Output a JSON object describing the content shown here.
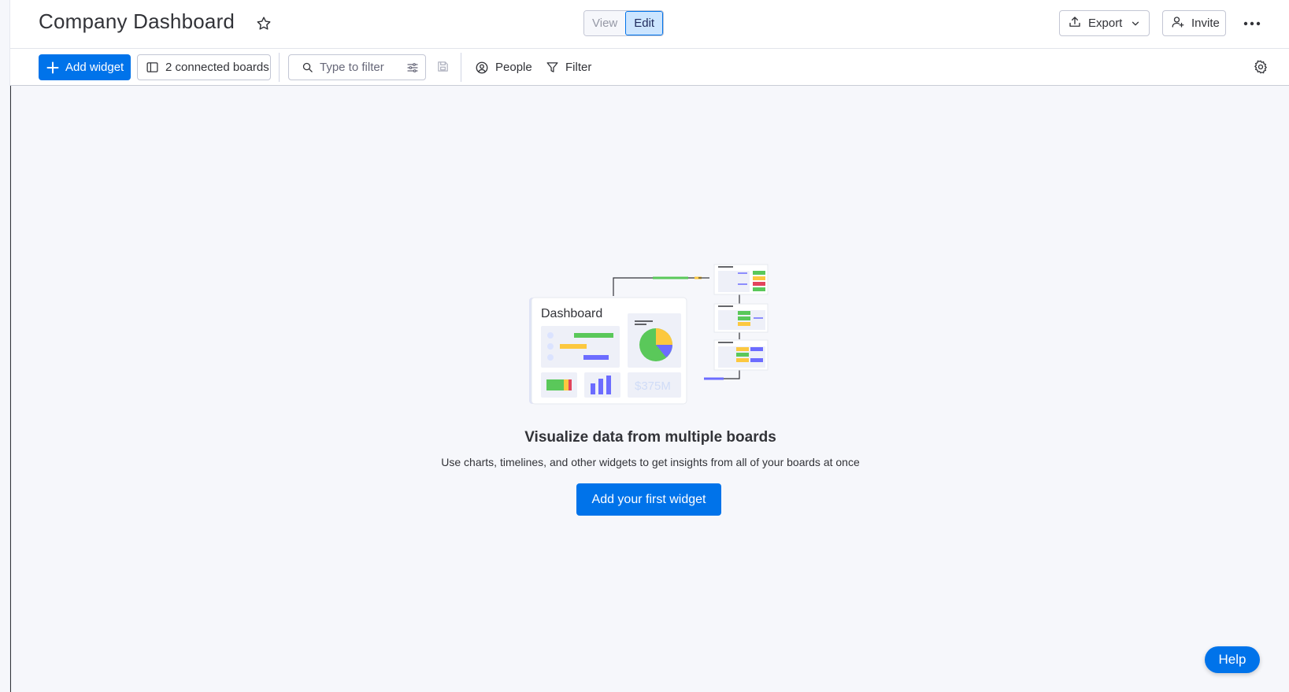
{
  "header": {
    "title": "Company Dashboard",
    "view_label": "View",
    "edit_label": "Edit",
    "export_label": "Export",
    "invite_label": "Invite"
  },
  "toolbar": {
    "add_widget_label": "Add widget",
    "connected_boards_label": "2 connected boards",
    "search_placeholder": "Type to filter",
    "people_label": "People",
    "filter_label": "Filter"
  },
  "empty_state": {
    "illustration_title": "Dashboard",
    "illustration_value": "$375M",
    "title": "Visualize data from multiple boards",
    "description": "Use charts, timelines, and other widgets to get insights from all of your boards at once",
    "cta_label": "Add your first widget"
  },
  "help_label": "Help",
  "colors": {
    "primary": "#0073ea",
    "canvas_bg": "#f6f7fb",
    "green": "#5ac85a",
    "yellow": "#fcc83f",
    "purple": "#6c6cff",
    "red": "#e2445c"
  }
}
